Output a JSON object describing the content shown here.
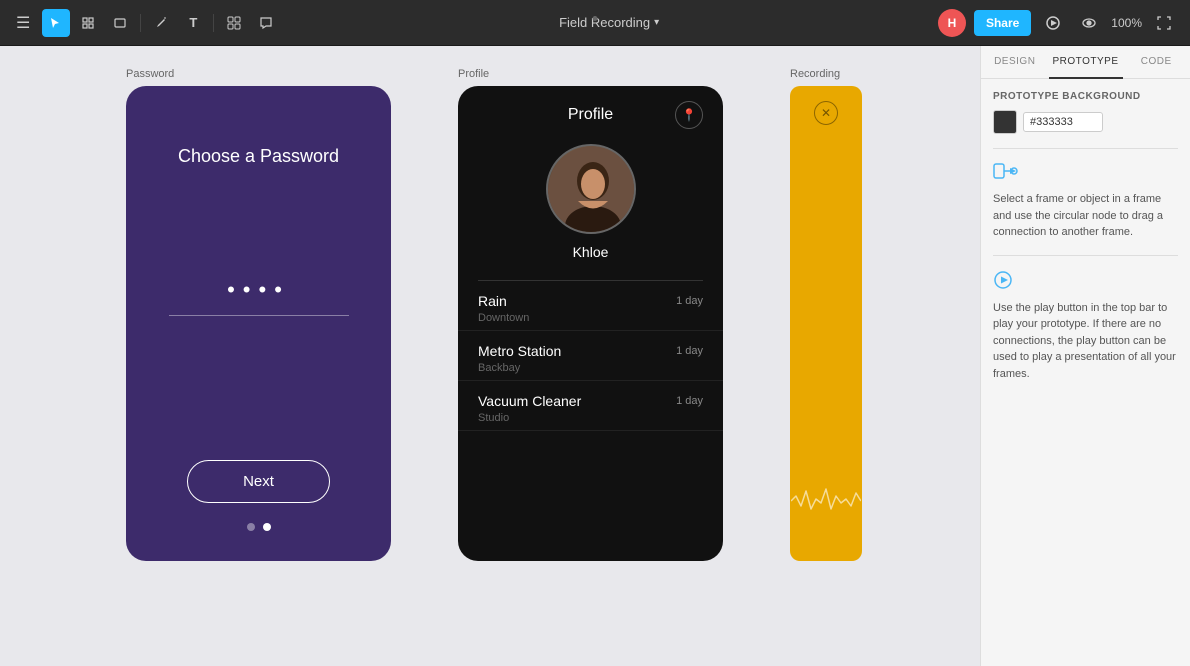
{
  "topbar": {
    "menu_icon": "≡",
    "project_title": "Field Recording",
    "project_title_caret": "▾",
    "share_label": "Share",
    "zoom_level": "100%",
    "avatar_initial": "H",
    "tools": [
      {
        "name": "select",
        "icon": "↖",
        "active": true
      },
      {
        "name": "frame",
        "icon": "⊞"
      },
      {
        "name": "rectangle",
        "icon": "□"
      },
      {
        "name": "pen",
        "icon": "✒"
      },
      {
        "name": "text",
        "icon": "T"
      },
      {
        "name": "grid",
        "icon": "⊞"
      },
      {
        "name": "comment",
        "icon": "○"
      }
    ]
  },
  "right_panel": {
    "tabs": [
      "Design",
      "Prototype",
      "Code"
    ],
    "active_tab": "Prototype",
    "section_title": "Prototype Background",
    "color_value": "#333333",
    "instruction1": {
      "icon": "arrow",
      "text": "Select a frame or object in a frame and use the circular node to drag a connection to another frame."
    },
    "instruction2": {
      "icon": "play",
      "text": "Use the play button in the top bar to play your prototype. If there are no connections, the play button can be used to play a presentation of all your frames."
    }
  },
  "frames": {
    "password": {
      "label": "Password",
      "title": "Choose a Password",
      "password_dots": "····",
      "next_button": "Next",
      "dots": [
        false,
        true
      ]
    },
    "profile": {
      "label": "Profile",
      "header_title": "Profile",
      "user_name": "Khloe",
      "tracks": [
        {
          "name": "Rain",
          "time": "1 day",
          "location": "Downtown"
        },
        {
          "name": "Metro Station",
          "time": "1 day",
          "location": "Backbay"
        },
        {
          "name": "Vacuum Cleaner",
          "time": "1 day",
          "location": "Studio"
        }
      ]
    },
    "recording": {
      "label": "Recording"
    }
  }
}
